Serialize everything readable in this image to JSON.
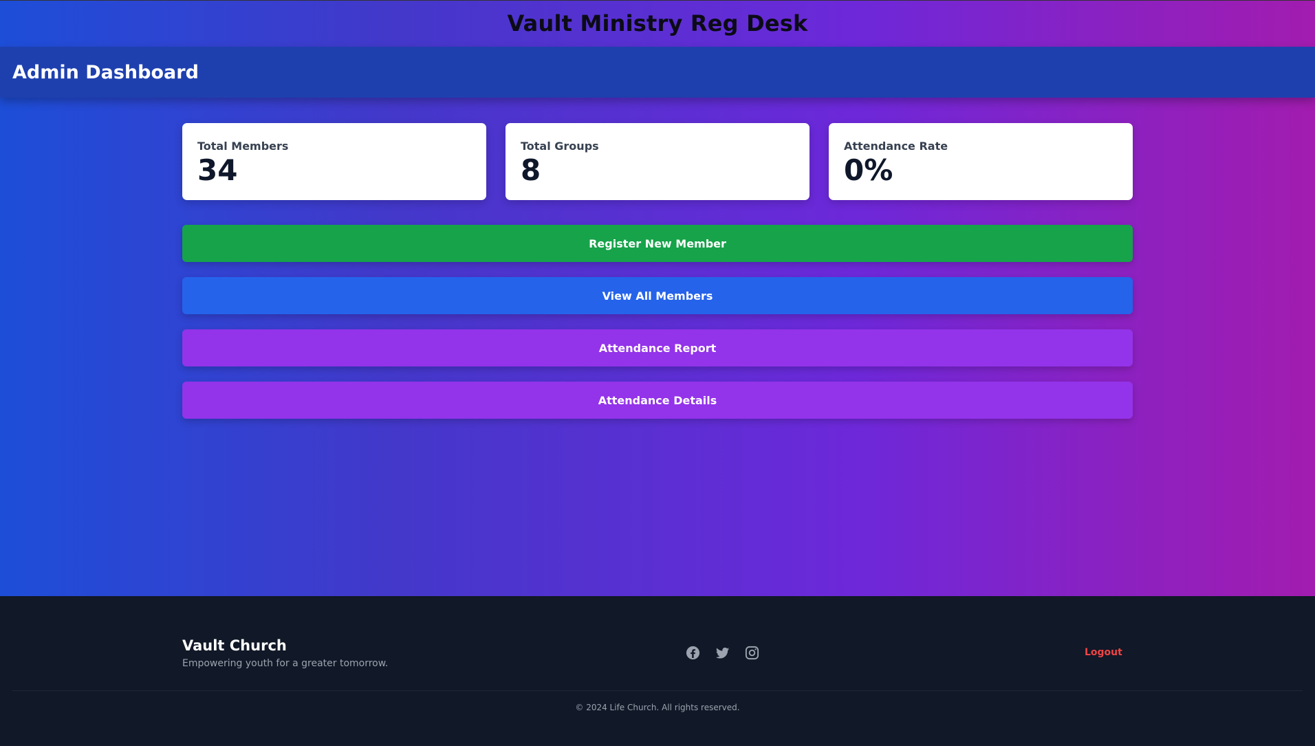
{
  "app": {
    "title": "Vault Ministry Reg Desk"
  },
  "header": {
    "title": "Admin Dashboard"
  },
  "stats": [
    {
      "label": "Total Members",
      "value": "34"
    },
    {
      "label": "Total Groups",
      "value": "8"
    },
    {
      "label": "Attendance Rate",
      "value": "0%"
    }
  ],
  "actions": {
    "register_label": "Register New Member",
    "view_members_label": "View All Members",
    "attendance_report_label": "Attendance Report",
    "attendance_details_label": "Attendance Details"
  },
  "footer": {
    "brand_name": "Vault Church",
    "tagline": "Empowering youth for a greater tomorrow.",
    "social_icons": [
      "facebook-icon",
      "twitter-icon",
      "instagram-icon"
    ],
    "logout_label": "Logout",
    "copyright": "© 2024 Life Church. All rights reserved."
  },
  "colors": {
    "gradient_start": "#1d4ed8",
    "gradient_end": "#a21caf",
    "header_bar": "#1e40af",
    "register_button": "#16a34a",
    "view_members_button": "#2563eb",
    "attendance_buttons": "#9333ea",
    "footer_bg": "#111827",
    "logout": "#ef4444"
  }
}
